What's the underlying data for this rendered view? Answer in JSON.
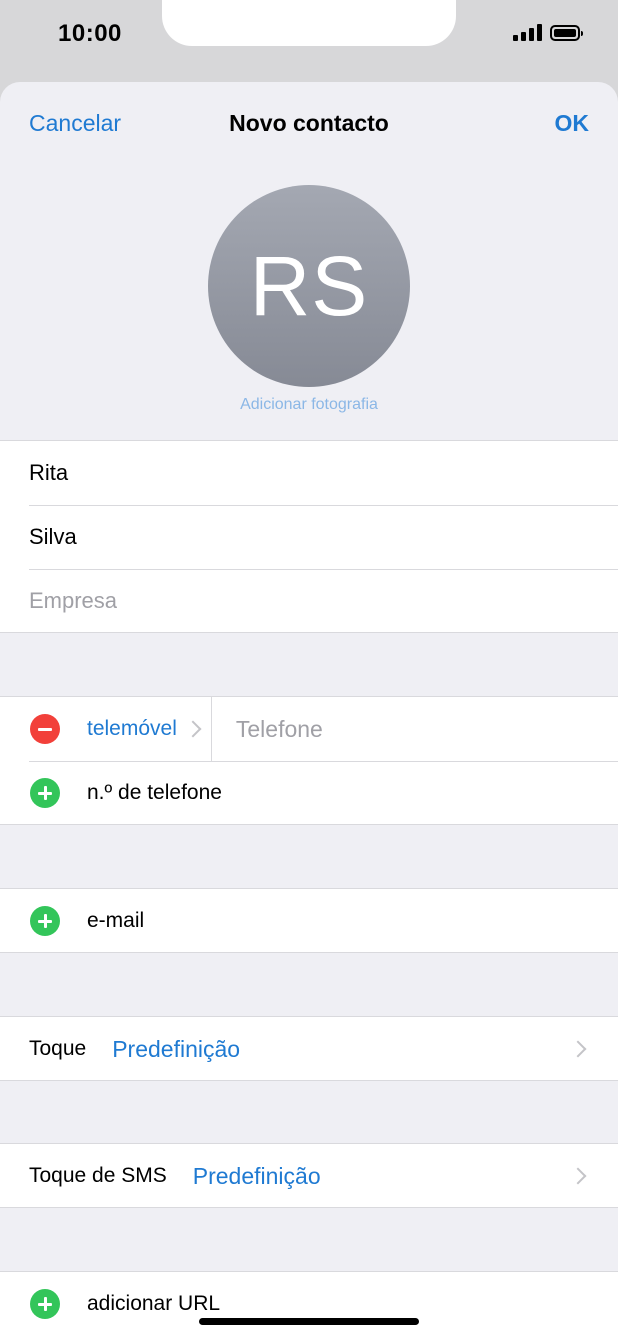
{
  "status_bar": {
    "time": "10:00",
    "icons": [
      "signal-icon",
      "battery-icon"
    ]
  },
  "nav": {
    "cancel_label": "Cancelar",
    "title": "Novo contacto",
    "ok_label": "OK"
  },
  "avatar": {
    "initials": "RS",
    "add_photo_label": "Adicionar fotografia"
  },
  "name_fields": {
    "first_name": "Rita",
    "last_name": "Silva",
    "company_placeholder": "Empresa"
  },
  "phone_section": {
    "type_label": "telemóvel",
    "phone_placeholder": "Telefone",
    "add_phone_label": "n.º de telefone"
  },
  "email_section": {
    "add_email_label": "e-mail"
  },
  "ringtone": {
    "label": "Toque",
    "value": "Predefinição"
  },
  "sms_tone": {
    "label": "Toque de SMS",
    "value": "Predefinição"
  },
  "url_section": {
    "add_url_label": "adicionar URL"
  },
  "colors": {
    "accent": "#1f7ad2",
    "remove": "#f2403a",
    "add": "#33c55a",
    "group_bg": "#efeff4"
  }
}
